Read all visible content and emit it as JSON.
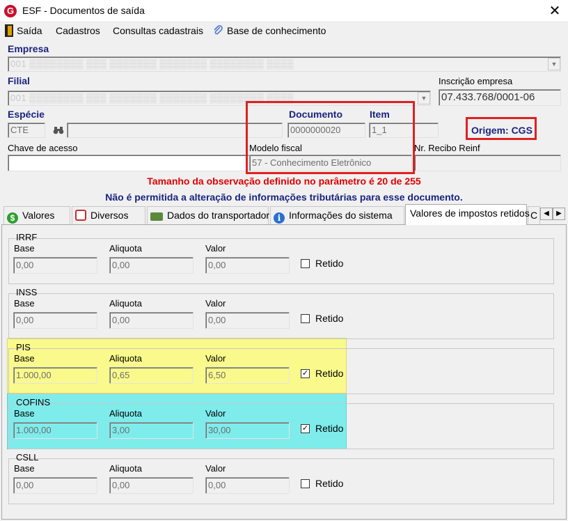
{
  "window": {
    "title": "ESF - Documentos de saída",
    "close_glyph": "✕",
    "logo_letter": "G"
  },
  "menu": {
    "saida": "Saída",
    "cadastros": "Cadastros",
    "consultas": "Consultas cadastrais",
    "base": "Base de conhecimento"
  },
  "empresa": {
    "label": "Empresa",
    "value": "001  ▒▒▒▒▒▒▒▒ ▒▒▒ ▒▒▒▒▒▒▒ ▒▒▒▒▒▒▒ ▒▒▒▒▒▒▒▒ ▒▒▒▒"
  },
  "filial": {
    "label": "Filial",
    "value": "001  ▒▒▒▒▒▒▒▒ ▒▒▒ ▒▒▒▒▒▒▒ ▒▒▒▒▒▒▒ ▒▒▒▒▒▒▒▒ ▒▒▒▒",
    "inscricao_label": "Inscrição empresa",
    "inscricao_value": "07.433.768/0001-06"
  },
  "especie": {
    "label": "Espécie",
    "value": "CTE"
  },
  "documento": {
    "label": "Documento",
    "value": "0000000020"
  },
  "item": {
    "label": "Item",
    "value": "1_1"
  },
  "origem": "Origem: CGS",
  "chave": {
    "label": "Chave de acesso",
    "value": ""
  },
  "modelo": {
    "label": "Modelo fiscal",
    "value": "57 - Conhecimento Eletrônico"
  },
  "recibo": {
    "label": "Nr. Recibo Reinf",
    "value": ""
  },
  "messages": {
    "line1": "Tamanho da observação definido no parâmetro é 20 de 255",
    "line2": "Não é permitida a alteração de informações tributárias para esse documento."
  },
  "tabs": [
    "Valores",
    "Diversos",
    "Dados do transportador",
    "Informações do sistema",
    "Valores de impostos retidos",
    "C"
  ],
  "columns": {
    "base": "Base",
    "aliquota": "Aliquota",
    "valor": "Valor",
    "retido": "Retido"
  },
  "taxes": [
    {
      "name": "IRRF",
      "base": "0,00",
      "aliquota": "0,00",
      "valor": "0,00",
      "retido": ""
    },
    {
      "name": "INSS",
      "base": "0,00",
      "aliquota": "0,00",
      "valor": "0,00",
      "retido": ""
    },
    {
      "name": "PIS",
      "base": "1.000,00",
      "aliquota": "0,65",
      "valor": "6,50",
      "retido": "✓"
    },
    {
      "name": "COFINS",
      "base": "1.000,00",
      "aliquota": "3,00",
      "valor": "30,00",
      "retido": "✓"
    },
    {
      "name": "CSLL",
      "base": "0,00",
      "aliquota": "0,00",
      "valor": "0,00",
      "retido": ""
    }
  ],
  "colors": {
    "label_blue": "#1a237e",
    "alert_red": "#e00000",
    "highlight_yellow": "#fafa8c",
    "highlight_cyan": "#7fecec",
    "callout_red": "#e02020"
  }
}
